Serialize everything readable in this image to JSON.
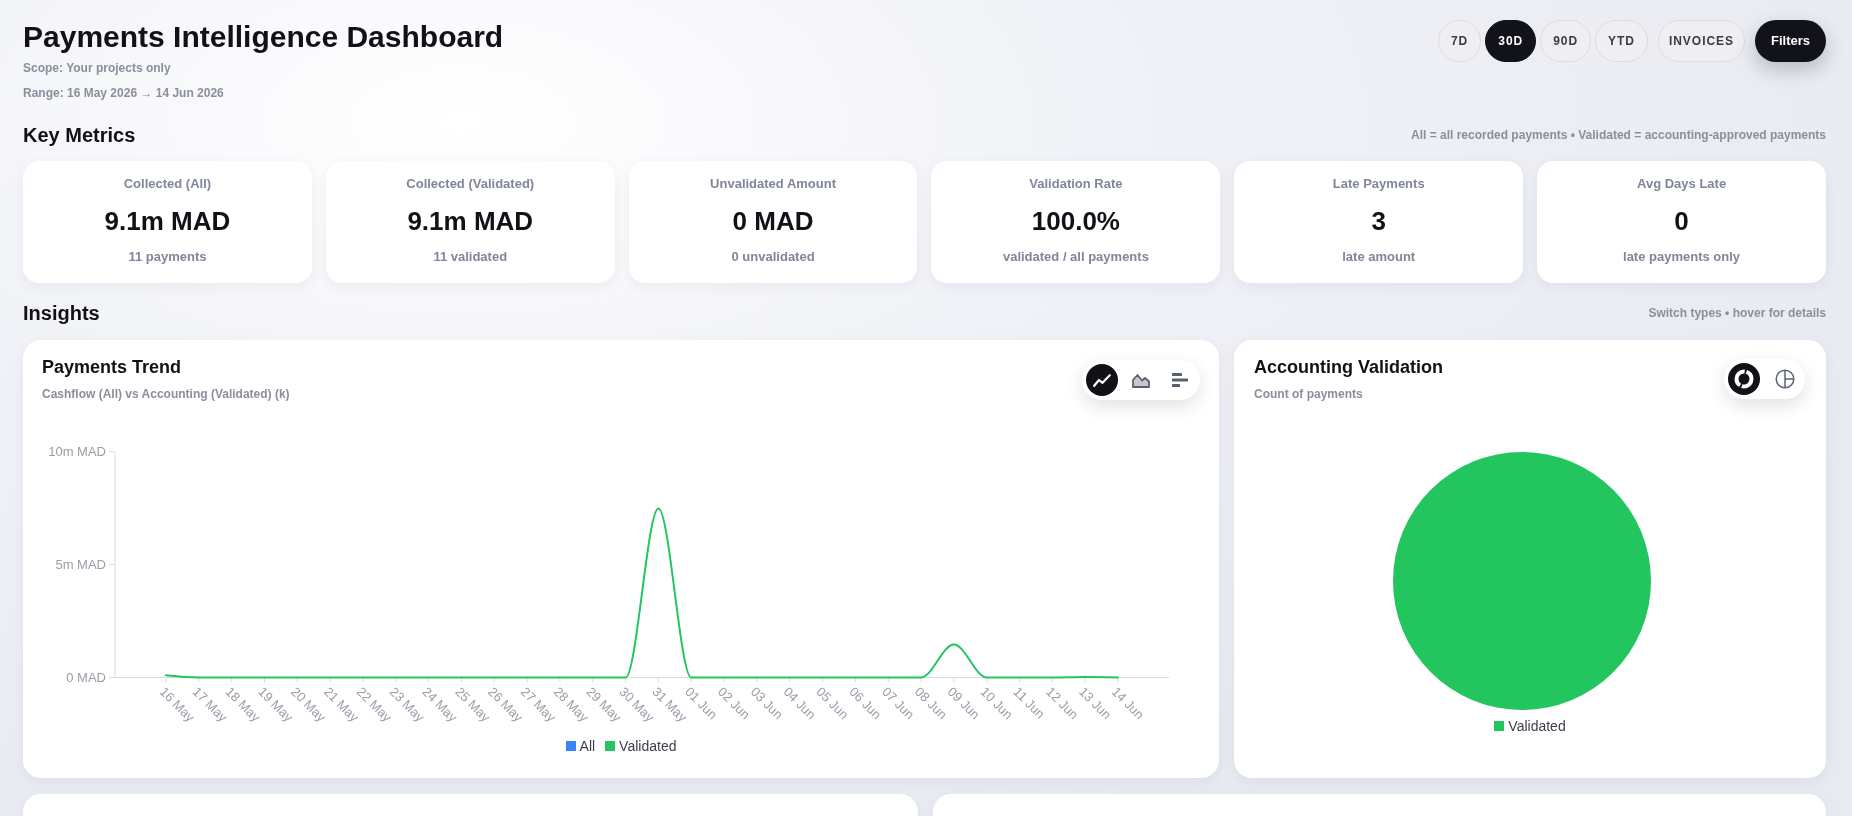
{
  "header": {
    "title": "Payments Intelligence Dashboard",
    "scope": "Scope: Your projects only",
    "range": "Range: 16 May 2026 → 14 Jun 2026"
  },
  "periods": [
    {
      "label": "7D",
      "selected": false
    },
    {
      "label": "30D",
      "selected": true
    },
    {
      "label": "90D",
      "selected": false
    },
    {
      "label": "YTD",
      "selected": false
    }
  ],
  "actions": [
    {
      "kind": "outline",
      "label": "INVOICES"
    },
    {
      "kind": "primary",
      "label": "Filters"
    }
  ],
  "key_metrics": {
    "heading": "Key Metrics",
    "note": "All = all recorded payments • Validated = accounting-approved payments",
    "cards": [
      {
        "label": "Collected (All)",
        "value": "9.1m MAD",
        "caption": "11 payments"
      },
      {
        "label": "Collected (Validated)",
        "value": "9.1m MAD",
        "caption": "11 validated"
      },
      {
        "label": "Unvalidated Amount",
        "value": "0 MAD",
        "caption": "0 unvalidated"
      },
      {
        "label": "Validation Rate",
        "value": "100.0%",
        "caption": "validated / all payments"
      },
      {
        "label": "Late Payments",
        "value": "3",
        "caption": "late amount"
      },
      {
        "label": "Avg Days Late",
        "value": "0",
        "caption": "late payments only"
      }
    ]
  },
  "insights": {
    "heading": "Insights",
    "note": "Switch types • hover for details",
    "trend": {
      "title": "Payments Trend",
      "subtitle": "Cashflow (All) vs Accounting (Validated) (k)",
      "chart_types": [
        {
          "kind": "line",
          "selected": true
        },
        {
          "kind": "area",
          "selected": false
        },
        {
          "kind": "bar",
          "selected": false
        }
      ],
      "chart_data": {
        "type": "line",
        "categories": [
          "16 May",
          "17 May",
          "18 May",
          "19 May",
          "20 May",
          "21 May",
          "22 May",
          "23 May",
          "24 May",
          "25 May",
          "26 May",
          "27 May",
          "28 May",
          "29 May",
          "30 May",
          "31 May",
          "01 Jun",
          "02 Jun",
          "03 Jun",
          "04 Jun",
          "05 Jun",
          "06 Jun",
          "07 Jun",
          "08 Jun",
          "09 Jun",
          "10 Jun",
          "11 Jun",
          "12 Jun",
          "13 Jun",
          "14 Jun"
        ],
        "series": [
          {
            "name": "All",
            "color": "#3b82f6",
            "values": [
              null,
              null,
              null,
              null,
              null,
              null,
              null,
              null,
              null,
              null,
              null,
              null,
              null,
              null,
              null,
              null,
              null,
              null,
              null,
              null,
              null,
              null,
              null,
              null,
              null,
              null,
              null,
              null,
              null,
              null
            ]
          },
          {
            "name": "Validated",
            "color": "#22c55e",
            "values": [
              100000,
              0,
              0,
              0,
              0,
              0,
              0,
              0,
              0,
              0,
              0,
              0,
              0,
              0,
              0,
              7480000,
              0,
              0,
              0,
              0,
              0,
              0,
              0,
              0,
              1460000,
              0,
              0,
              0,
              20000,
              0
            ]
          }
        ],
        "ylim": [
          0,
          10000000
        ],
        "yticks": [
          {
            "value": 0,
            "label": "0 MAD"
          },
          {
            "value": 5000000,
            "label": "5m MAD"
          },
          {
            "value": 10000000,
            "label": "10m MAD"
          }
        ]
      }
    },
    "validation": {
      "title": "Accounting Validation",
      "subtitle": "Count of payments",
      "chart_types": [
        {
          "kind": "donut",
          "selected": true
        },
        {
          "kind": "pie",
          "selected": false
        }
      ],
      "legend": [
        {
          "label": "Validated",
          "color": "#22c55e"
        }
      ]
    }
  }
}
